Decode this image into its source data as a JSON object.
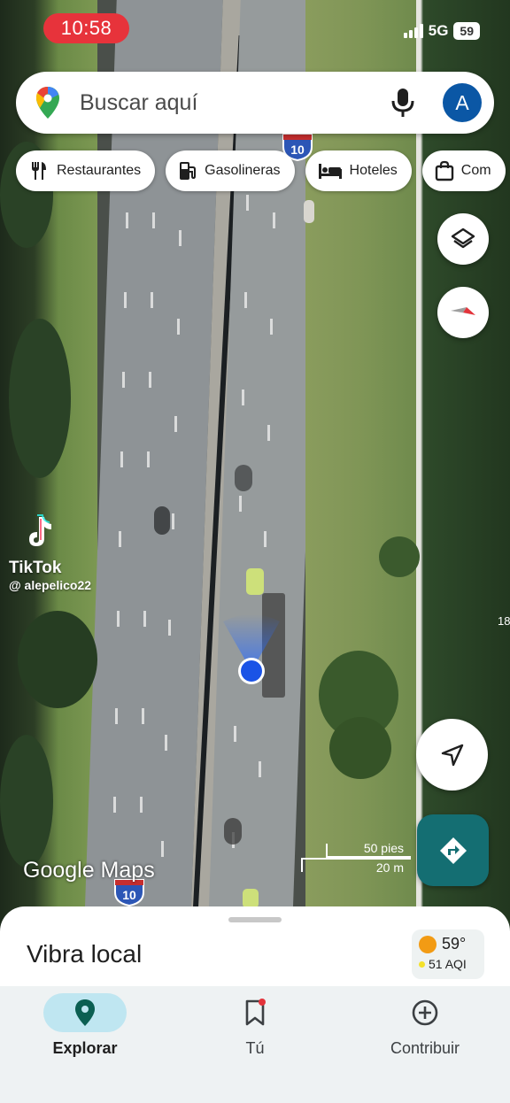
{
  "status_bar": {
    "time": "10:58",
    "network": "5G",
    "battery": "59"
  },
  "search": {
    "placeholder": "Buscar aquí",
    "avatar_letter": "A"
  },
  "chips": [
    {
      "label": "Restaurantes",
      "icon": "fork-knife-icon"
    },
    {
      "label": "Gasolineras",
      "icon": "gas-pump-icon"
    },
    {
      "label": "Hoteles",
      "icon": "bed-icon"
    },
    {
      "label": "Com",
      "icon": "shopping-bag-icon"
    }
  ],
  "map": {
    "highway_shield_top": "10",
    "highway_shield_bottom": "10",
    "logo": "Google Maps",
    "scale_feet": "50 pies",
    "scale_meters": "20 m",
    "edge_number": "18"
  },
  "overlay": {
    "brand": "TikTok",
    "handle": "@ alepelico22"
  },
  "sheet": {
    "title": "Vibra local",
    "temperature": "59°",
    "aqi": "51 AQI"
  },
  "nav": [
    {
      "label": "Explorar",
      "icon": "pin-icon",
      "active": true
    },
    {
      "label": "Tú",
      "icon": "bookmark-icon",
      "active": false
    },
    {
      "label": "Contribuir",
      "icon": "add-circle-icon",
      "active": false
    }
  ],
  "colors": {
    "accent": "#146e72",
    "avatar": "#0b57a5",
    "time_pill": "#e7333b",
    "location_dot": "#1a53e6"
  }
}
